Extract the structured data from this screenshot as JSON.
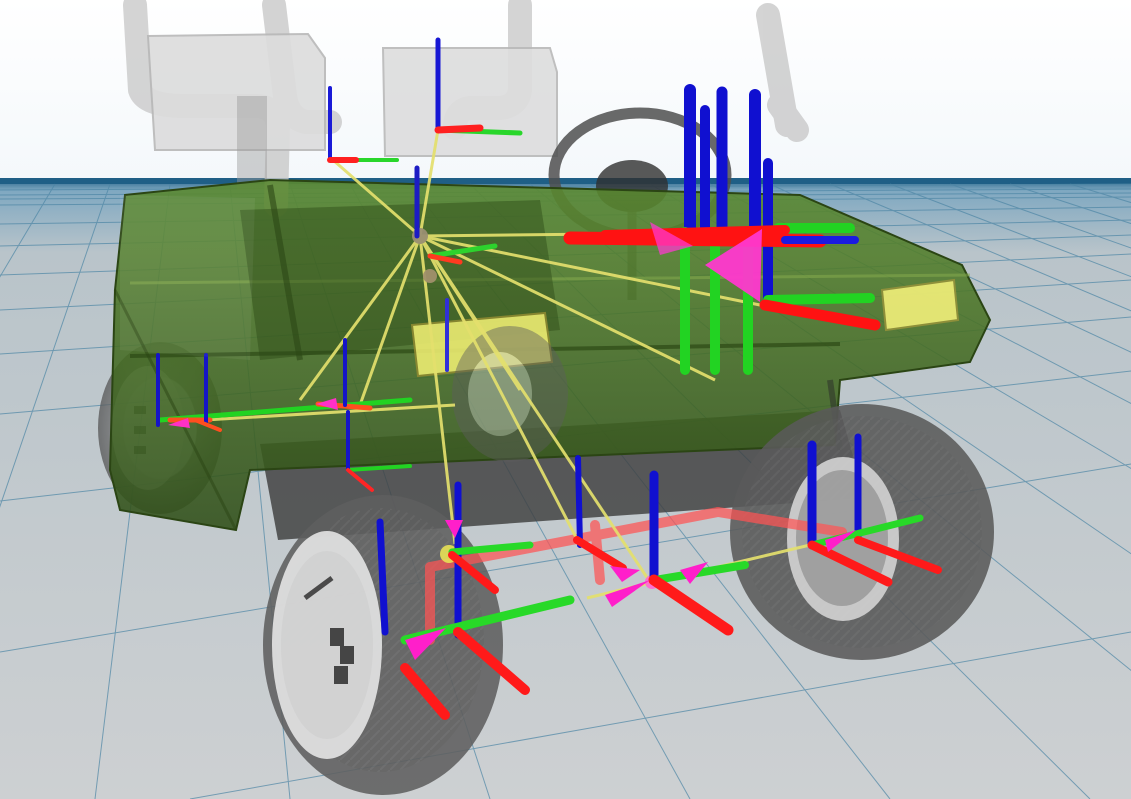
{
  "app": {
    "title": ""
  },
  "scene": {
    "sky_color": "#ffffff",
    "horizon_color": "#1f5f86",
    "ground_color": "#c7cbce",
    "grid_color": "#4d86a5",
    "body_color": "#3f6d1f",
    "frame_color": "#9b9b9b",
    "wheel_color": "#606060",
    "axis_x_color": "#ff1a1a",
    "axis_y_color": "#1fd11f",
    "axis_z_color": "#1010d0",
    "joint_color": "#ff33cc",
    "link_color": "#e4e06d",
    "objects": [
      "roll-cage",
      "vehicle-body",
      "front-left-wheel",
      "front-right-wheel",
      "rear-left-wheel",
      "rear-right-wheel",
      "steering-wheel",
      "coordinate-frames",
      "joint-links"
    ]
  }
}
